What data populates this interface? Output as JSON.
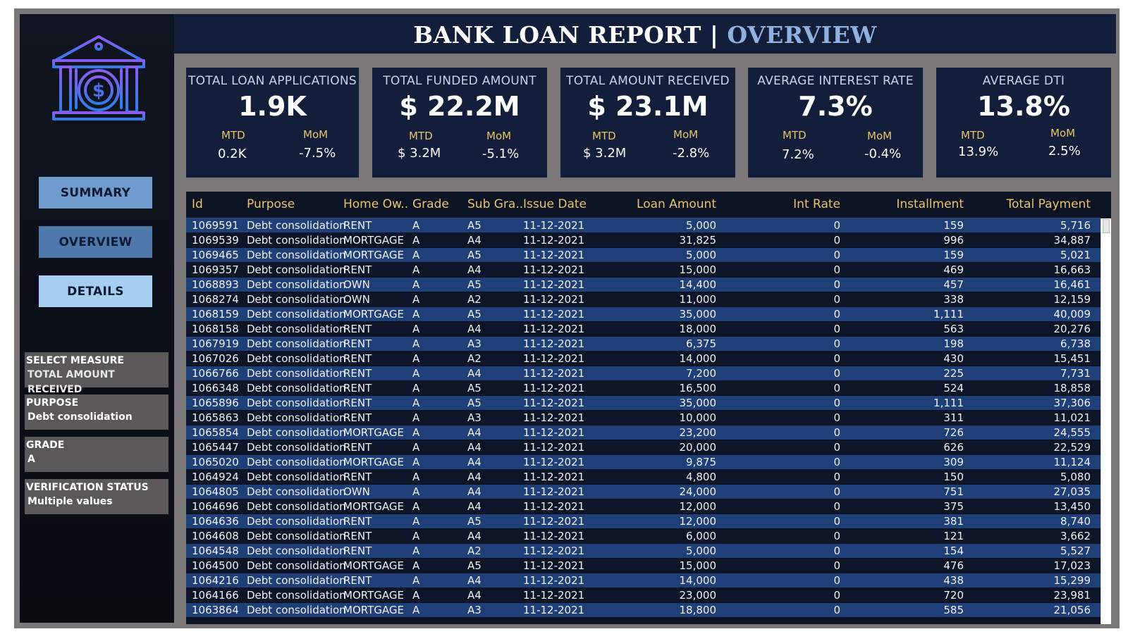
{
  "title": {
    "main": "BANK LOAN REPORT",
    "sep": "|",
    "sub": "OVERVIEW"
  },
  "nav": {
    "summary": "SUMMARY",
    "overview": "OVERVIEW",
    "details": "DETAILS"
  },
  "filters": [
    {
      "label": "SELECT MEASURE",
      "value": "TOTAL AMOUNT RECEIVED"
    },
    {
      "label": "PURPOSE",
      "value": "Debt consolidation"
    },
    {
      "label": "GRADE",
      "value": "A"
    },
    {
      "label": "VERIFICATION STATUS",
      "value": "Multiple values"
    }
  ],
  "kpis": [
    {
      "title": "TOTAL LOAN APPLICATIONS",
      "value": "1.9K",
      "mtd_label": "MTD",
      "mtd": "0.2K",
      "mom_label": "MoM",
      "mom": "-7.5%"
    },
    {
      "title": "TOTAL FUNDED AMOUNT",
      "value": "$ 22.2M",
      "mtd_label": "MTD",
      "mtd": "$ 3.2M",
      "mom_label": "MoM",
      "mom": "-5.1%"
    },
    {
      "title": "TOTAL  AMOUNT RECEIVED",
      "value": "$ 23.1M",
      "mtd_label": "MTD",
      "mtd": "$ 3.2M",
      "mom_label": "MoM",
      "mom": "-2.8%"
    },
    {
      "title": "AVERAGE INTEREST RATE",
      "value": "7.3%",
      "mtd_label": "MTD",
      "mtd": "7.2%",
      "mom_label": "MoM",
      "mom": "-0.4%"
    },
    {
      "title": "AVERAGE DTI",
      "value": "13.8%",
      "mtd_label": "MTD",
      "mtd": "13.9%",
      "mom_label": "MoM",
      "mom": "2.5%"
    }
  ],
  "table": {
    "headers": [
      "Id",
      "Purpose",
      "Home Ow..",
      "Grade",
      "Sub Gra..",
      "Issue Date",
      "Loan Amount",
      "Int Rate",
      "Installment",
      "Total Payment"
    ],
    "rows": [
      [
        "1069591",
        "Debt consolidation",
        "RENT",
        "A",
        "A5",
        "11-12-2021",
        "5,000",
        "0",
        "159",
        "5,716"
      ],
      [
        "1069539",
        "Debt consolidation",
        "MORTGAGE",
        "A",
        "A4",
        "11-12-2021",
        "31,825",
        "0",
        "996",
        "34,887"
      ],
      [
        "1069465",
        "Debt consolidation",
        "MORTGAGE",
        "A",
        "A5",
        "11-12-2021",
        "5,000",
        "0",
        "159",
        "5,021"
      ],
      [
        "1069357",
        "Debt consolidation",
        "RENT",
        "A",
        "A4",
        "11-12-2021",
        "15,000",
        "0",
        "469",
        "16,663"
      ],
      [
        "1068893",
        "Debt consolidation",
        "OWN",
        "A",
        "A5",
        "11-12-2021",
        "14,400",
        "0",
        "457",
        "16,461"
      ],
      [
        "1068274",
        "Debt consolidation",
        "OWN",
        "A",
        "A2",
        "11-12-2021",
        "11,000",
        "0",
        "338",
        "12,159"
      ],
      [
        "1068159",
        "Debt consolidation",
        "MORTGAGE",
        "A",
        "A5",
        "11-12-2021",
        "35,000",
        "0",
        "1,111",
        "40,009"
      ],
      [
        "1068158",
        "Debt consolidation",
        "RENT",
        "A",
        "A4",
        "11-12-2021",
        "18,000",
        "0",
        "563",
        "20,276"
      ],
      [
        "1067919",
        "Debt consolidation",
        "RENT",
        "A",
        "A3",
        "11-12-2021",
        "6,375",
        "0",
        "198",
        "6,738"
      ],
      [
        "1067026",
        "Debt consolidation",
        "RENT",
        "A",
        "A2",
        "11-12-2021",
        "14,000",
        "0",
        "430",
        "15,451"
      ],
      [
        "1066766",
        "Debt consolidation",
        "RENT",
        "A",
        "A4",
        "11-12-2021",
        "7,200",
        "0",
        "225",
        "7,731"
      ],
      [
        "1066348",
        "Debt consolidation",
        "RENT",
        "A",
        "A5",
        "11-12-2021",
        "16,500",
        "0",
        "524",
        "18,858"
      ],
      [
        "1065896",
        "Debt consolidation",
        "RENT",
        "A",
        "A5",
        "11-12-2021",
        "35,000",
        "0",
        "1,111",
        "37,306"
      ],
      [
        "1065863",
        "Debt consolidation",
        "RENT",
        "A",
        "A3",
        "11-12-2021",
        "10,000",
        "0",
        "311",
        "11,021"
      ],
      [
        "1065854",
        "Debt consolidation",
        "MORTGAGE",
        "A",
        "A4",
        "11-12-2021",
        "23,200",
        "0",
        "726",
        "24,555"
      ],
      [
        "1065447",
        "Debt consolidation",
        "RENT",
        "A",
        "A4",
        "11-12-2021",
        "20,000",
        "0",
        "626",
        "22,529"
      ],
      [
        "1065020",
        "Debt consolidation",
        "MORTGAGE",
        "A",
        "A4",
        "11-12-2021",
        "9,875",
        "0",
        "309",
        "11,124"
      ],
      [
        "1064924",
        "Debt consolidation",
        "RENT",
        "A",
        "A4",
        "11-12-2021",
        "4,800",
        "0",
        "150",
        "5,080"
      ],
      [
        "1064805",
        "Debt consolidation",
        "OWN",
        "A",
        "A4",
        "11-12-2021",
        "24,000",
        "0",
        "751",
        "27,035"
      ],
      [
        "1064696",
        "Debt consolidation",
        "MORTGAGE",
        "A",
        "A4",
        "11-12-2021",
        "12,000",
        "0",
        "375",
        "13,450"
      ],
      [
        "1064636",
        "Debt consolidation",
        "RENT",
        "A",
        "A5",
        "11-12-2021",
        "12,000",
        "0",
        "381",
        "8,740"
      ],
      [
        "1064608",
        "Debt consolidation",
        "RENT",
        "A",
        "A4",
        "11-12-2021",
        "6,000",
        "0",
        "121",
        "3,662"
      ],
      [
        "1064548",
        "Debt consolidation",
        "RENT",
        "A",
        "A2",
        "11-12-2021",
        "5,000",
        "0",
        "154",
        "5,527"
      ],
      [
        "1064500",
        "Debt consolidation",
        "MORTGAGE",
        "A",
        "A5",
        "11-12-2021",
        "15,000",
        "0",
        "476",
        "17,023"
      ],
      [
        "1064216",
        "Debt consolidation",
        "RENT",
        "A",
        "A4",
        "11-12-2021",
        "14,000",
        "0",
        "438",
        "15,299"
      ],
      [
        "1064166",
        "Debt consolidation",
        "MORTGAGE",
        "A",
        "A4",
        "11-12-2021",
        "23,000",
        "0",
        "720",
        "23,981"
      ],
      [
        "1063864",
        "Debt consolidation",
        "MORTGAGE",
        "A",
        "A3",
        "11-12-2021",
        "18,800",
        "0",
        "585",
        "21,056"
      ]
    ]
  },
  "colors": {
    "accent": "#e8c46a",
    "panel": "#131e3a",
    "row_odd": "#1f3f78",
    "row_even": "#0d1629",
    "title_sub": "#8fb1e0"
  },
  "icons": {
    "logo": "bank-dollar-icon"
  }
}
